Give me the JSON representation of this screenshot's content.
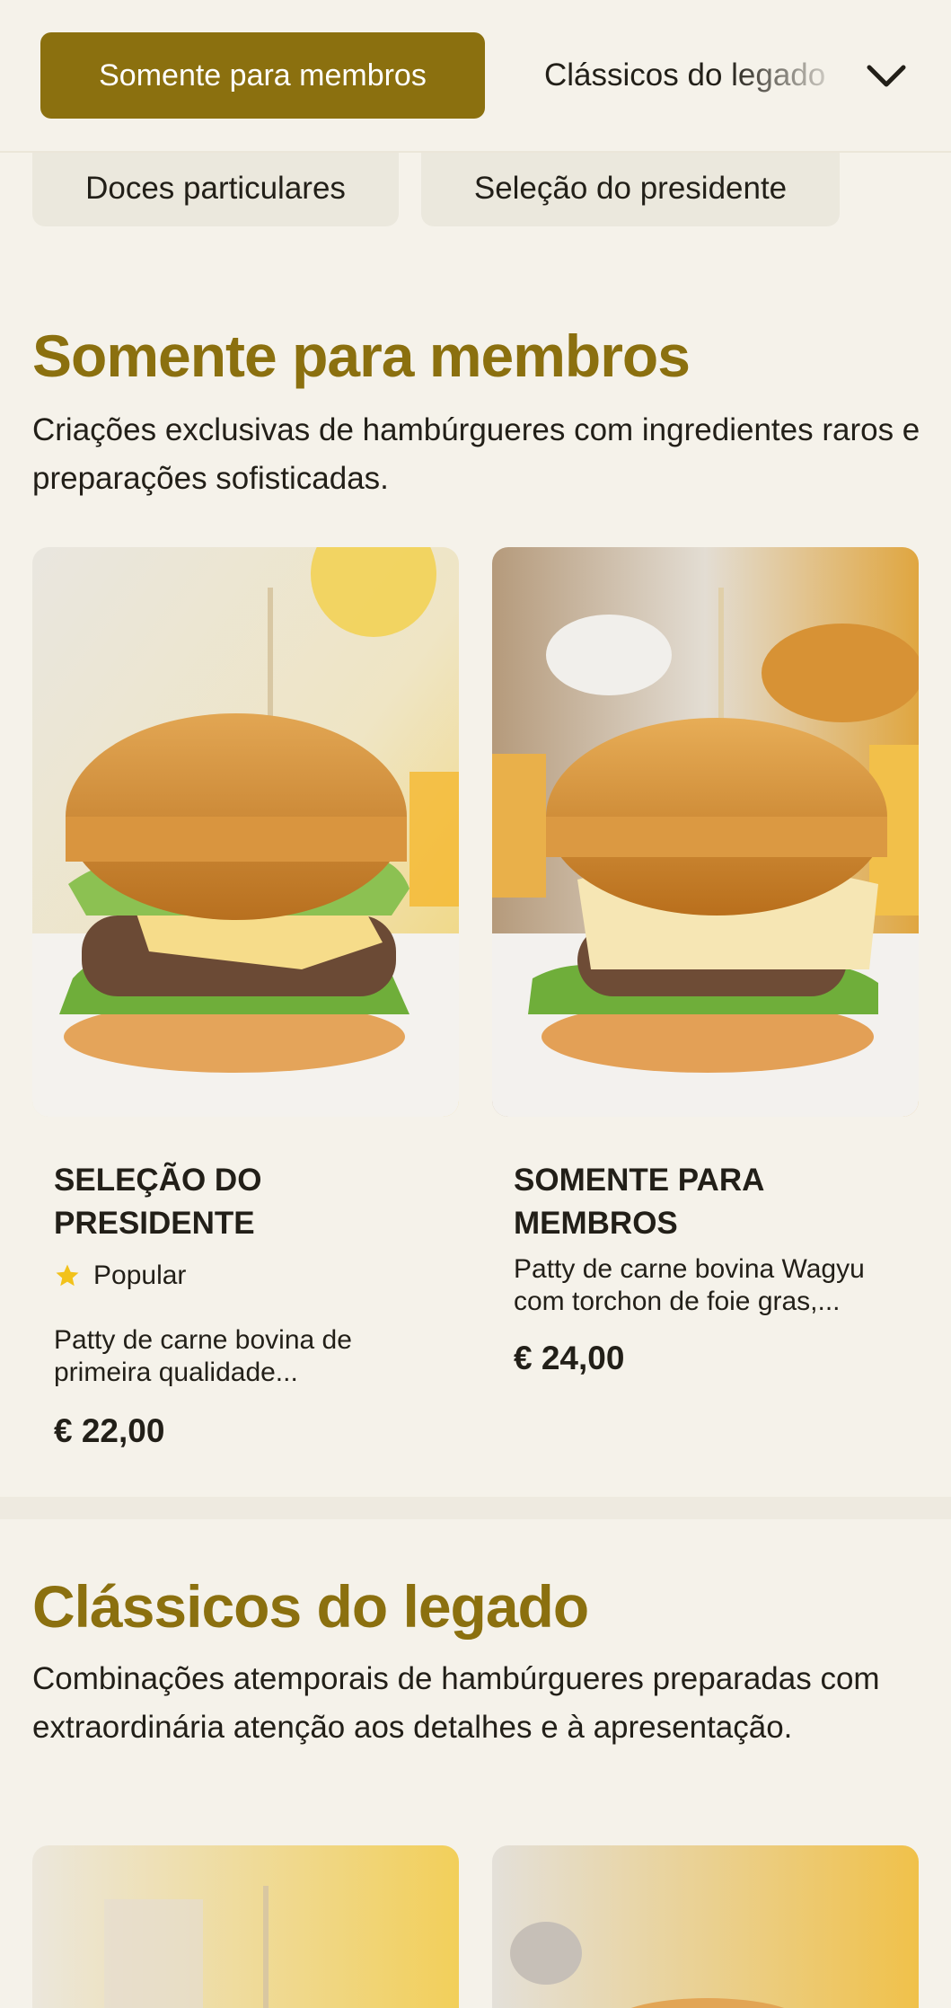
{
  "nav": {
    "active_category": "Somente para membros",
    "next_category": "Clássicos do legado",
    "chips": [
      "Doces particulares",
      "Seleção do presidente"
    ]
  },
  "members": {
    "title": "Somente para membros",
    "description": "Criações exclusivas de hambúrgueres com ingredientes raros e preparações sofisticadas.",
    "products": [
      {
        "name": "SELEÇÃO DO PRESIDENTE",
        "badge": "Popular",
        "description": "Patty de carne bovina de primeira qualidade...",
        "price": "€ 22,00"
      },
      {
        "name": "SOMENTE PARA MEMBROS",
        "description": "Patty de carne bovina Wagyu com torchon de foie gras,...",
        "price": "€ 24,00"
      }
    ]
  },
  "classics": {
    "title": "Clássicos do legado",
    "description": "Combinações atemporais de hambúrgueres preparadas com extraordinária atenção aos detalhes e à apresentação."
  },
  "colors": {
    "accent": "#8b700f",
    "background": "#f5f2ea",
    "chip": "#ebe8dd",
    "star": "#f2c21b"
  },
  "icons": {
    "dropdown": "chevron-down-icon",
    "badge": "star-icon"
  }
}
